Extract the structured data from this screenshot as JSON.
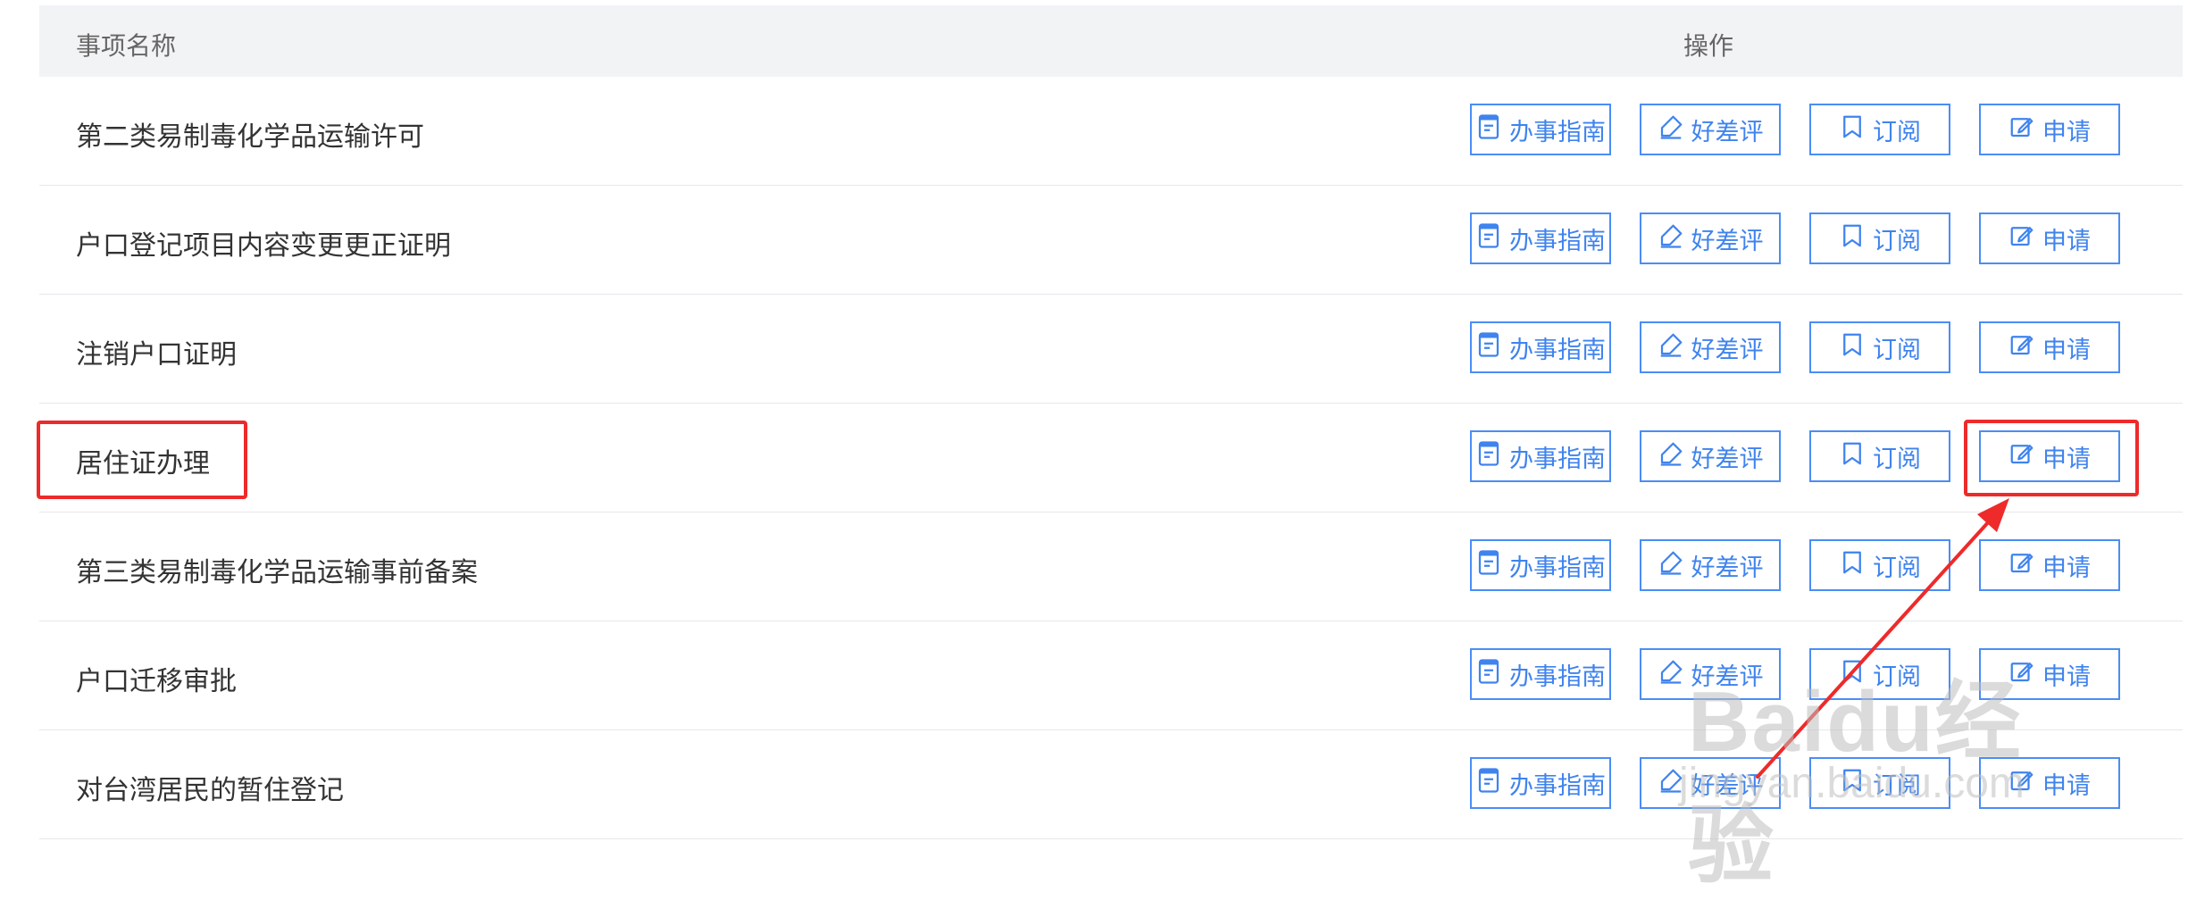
{
  "header": {
    "name_col": "事项名称",
    "op_col": "操作"
  },
  "buttons": {
    "guide": "办事指南",
    "review": "好差评",
    "subscribe": "订阅",
    "apply": "申请"
  },
  "rows": [
    {
      "name": "第二类易制毒化学品运输许可"
    },
    {
      "name": "户口登记项目内容变更更正证明"
    },
    {
      "name": "注销户口证明"
    },
    {
      "name": "居住证办理"
    },
    {
      "name": "第三类易制毒化学品运输事前备案"
    },
    {
      "name": "户口迁移审批"
    },
    {
      "name": "对台湾居民的暂住登记"
    }
  ],
  "watermark": {
    "logo": "Baidu经验",
    "url": "jingyan.baidu.com"
  },
  "colors": {
    "accent": "#3f83ee",
    "annotation": "#ee2a2a",
    "header_bg": "#f2f3f5"
  }
}
